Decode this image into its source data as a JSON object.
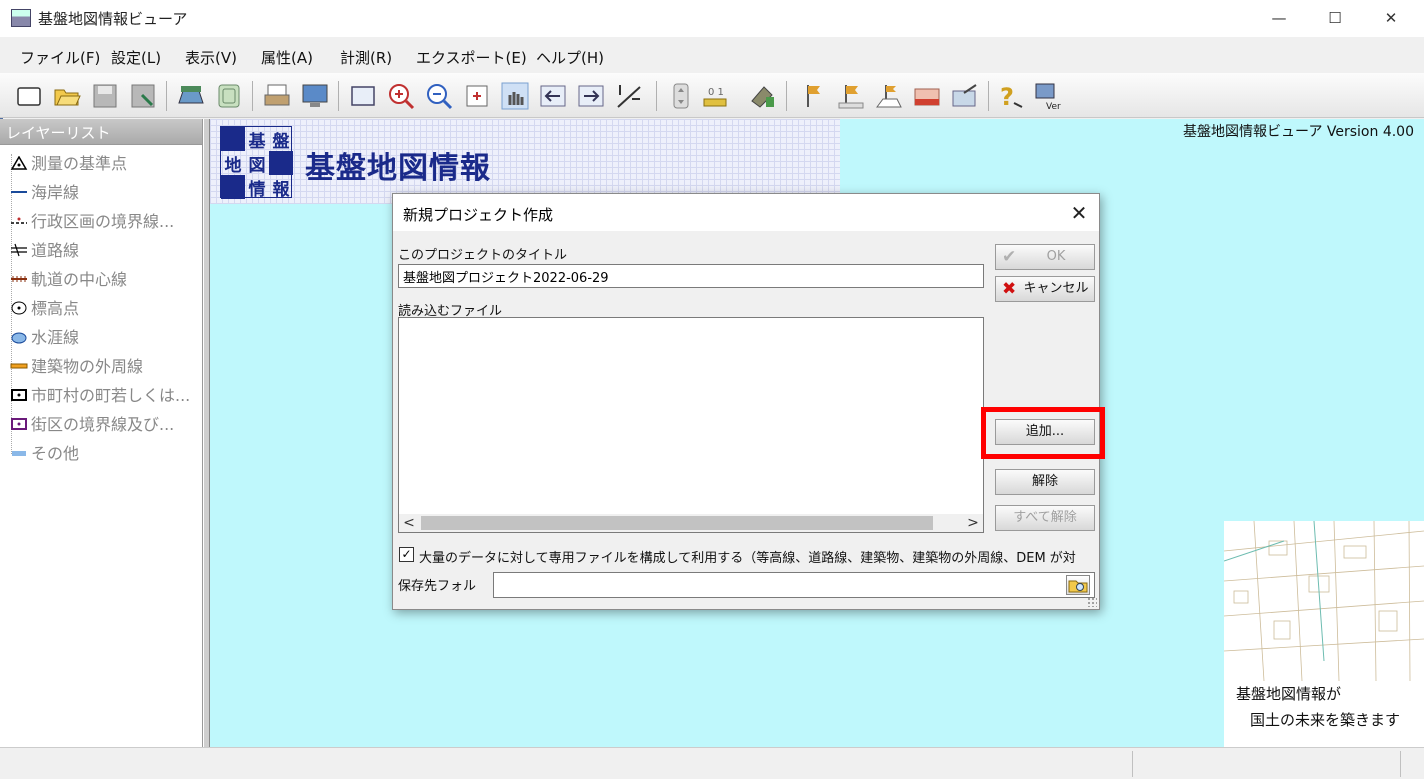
{
  "window": {
    "title": "基盤地図情報ビューア",
    "minimize": "—",
    "maximize": "☐",
    "close": "✕"
  },
  "menu": [
    "ファイル(F)",
    "設定(L)",
    "表示(V)",
    "属性(A)",
    "計測(R)",
    "エクスポート(E)",
    "ヘルプ(H)"
  ],
  "toolbar_icons": [
    "new-file-icon",
    "open-folder-icon",
    "save-icon",
    "save-as-icon",
    "layer-icon",
    "map-icon",
    "print-icon",
    "display-icon",
    "select-rect-icon",
    "zoom-in-icon",
    "zoom-out-icon",
    "zoom-box-icon",
    "pan-hand-icon",
    "back-icon",
    "forward-icon",
    "scale-icon",
    "height-icon",
    "measure-icon",
    "attribute-icon",
    "flag-icon",
    "flag-up-icon",
    "flag-home-icon",
    "export-shape-icon",
    "export-file-icon",
    "help-icon",
    "version-icon"
  ],
  "layer_list": {
    "header": "レイヤーリスト",
    "items": [
      {
        "label": "測量の基準点",
        "icon": "survey-point-icon"
      },
      {
        "label": "海岸線",
        "icon": "coastline-icon"
      },
      {
        "label": "行政区画の境界線...",
        "icon": "admin-boundary-icon"
      },
      {
        "label": "道路線",
        "icon": "road-icon"
      },
      {
        "label": "軌道の中心線",
        "icon": "railway-icon"
      },
      {
        "label": "標高点",
        "icon": "elevation-point-icon"
      },
      {
        "label": "水涯線",
        "icon": "waterline-icon"
      },
      {
        "label": "建築物の外周線",
        "icon": "building-icon"
      },
      {
        "label": "市町村の町若しくは...",
        "icon": "town-boundary-icon"
      },
      {
        "label": "街区の境界線及び...",
        "icon": "block-boundary-icon"
      },
      {
        "label": "その他",
        "icon": "other-icon"
      }
    ]
  },
  "banner": {
    "logo_chars": [
      "基",
      "盤",
      "地",
      "図",
      "情",
      "報"
    ],
    "title": "基盤地図情報"
  },
  "version_text": "基盤地図情報ビューア Version 4.00",
  "inset": {
    "line1": "基盤地図情報が",
    "line2": "国土の未来を築きます"
  },
  "dialog": {
    "title": "新規プロジェクト作成",
    "close": "✕",
    "project_title_label": "このプロジェクトのタイトル",
    "project_title_value": "基盤地図プロジェクト2022-06-29",
    "files_label": "読み込むファイル",
    "scroll_left": "<",
    "scroll_right": ">",
    "ok_label": "OK",
    "cancel_label": "キャンセル",
    "add_label": "追加...",
    "remove_label": "解除",
    "remove_all_label": "すべて解除",
    "checkbox_checked": "✓",
    "checkbox_label": "大量のデータに対して専用ファイルを構成して利用する（等高線、道路線、建築物、建築物の外周線、DEM が対",
    "save_folder_label": "保存先フォル",
    "save_folder_value": ""
  },
  "colors": {
    "map_background": "#bff8fc",
    "banner_blue": "#1a2a8a",
    "highlight": "#ff0000"
  }
}
